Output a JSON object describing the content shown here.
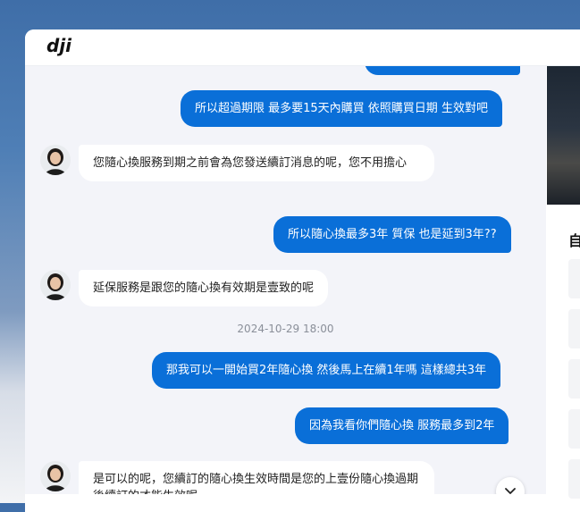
{
  "brand": {
    "logo_text": "dji"
  },
  "messages": {
    "u0": "",
    "u1": "所以超過期限 最多要15天內購買 依照購買日期 生效對吧",
    "a1": "您隨心換服務到期之前會為您發送續訂消息的呢，您不用擔心",
    "u2": "所以隨心換最多3年 質保 也是延到3年??",
    "a2": "延保服務是跟您的隨心換有效期是壹致的呢",
    "timestamp": "2024-10-29 18:00",
    "u3": "那我可以一開始買2年隨心換 然後馬上在續1年嗎 這樣總共3年",
    "u4": "因為我看你們隨心換 服務最多到2年",
    "a3": "是可以的呢，您續訂的隨心換生效時間是您的上壹份隨心換過期後續訂的才能生效呢"
  },
  "side": {
    "title": "自"
  },
  "icons": {
    "avatar": "agent-avatar",
    "scroll": "chevron-down-icon"
  }
}
